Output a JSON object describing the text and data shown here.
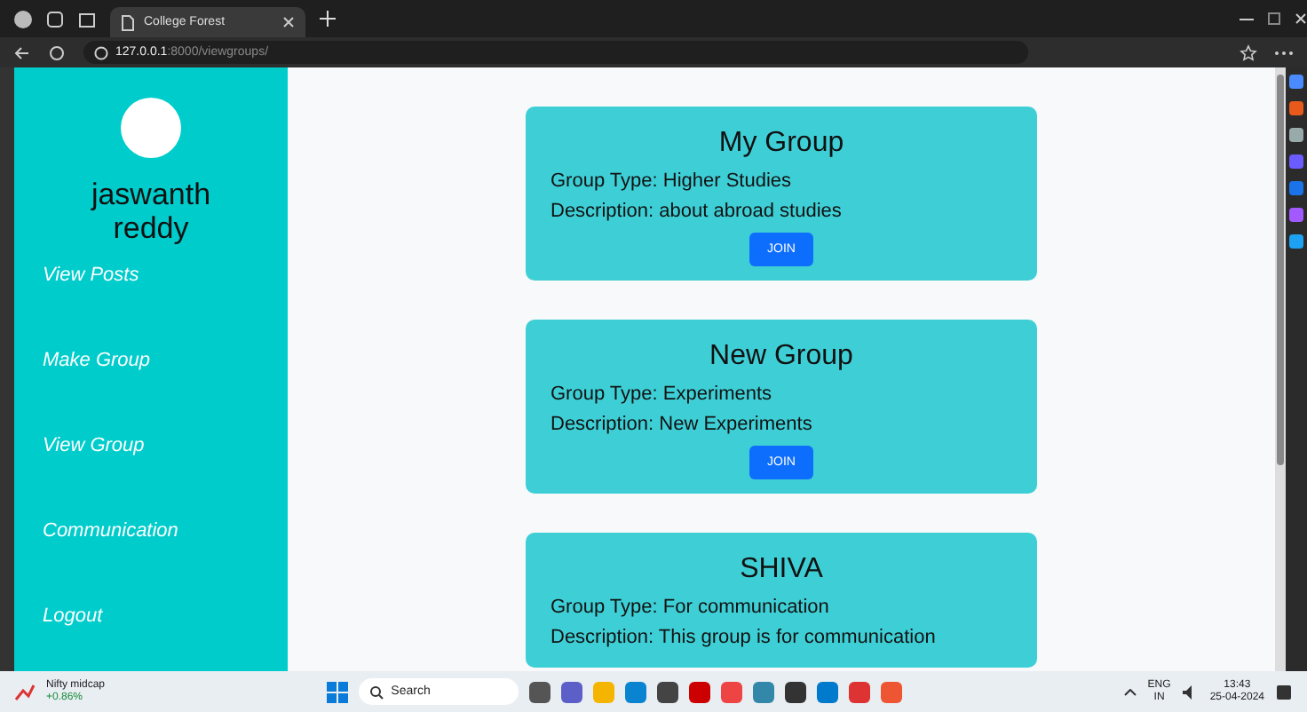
{
  "browser": {
    "tab_title": "College Forest",
    "url_host": "127.0.0.1",
    "url_path": ":8000/viewgroups/"
  },
  "sidebar": {
    "user_name": "jaswanth reddy",
    "items": [
      {
        "label": "View Posts"
      },
      {
        "label": "Make Group"
      },
      {
        "label": "View Group"
      },
      {
        "label": "Communication"
      },
      {
        "label": "Logout"
      }
    ]
  },
  "groups": [
    {
      "name": "My Group",
      "type_line": "Group Type: Higher Studies",
      "description_line": "Description: about abroad studies",
      "button": "JOIN"
    },
    {
      "name": "New Group",
      "type_line": "Group Type: Experiments",
      "description_line": "Description: New Experiments",
      "button": "JOIN"
    },
    {
      "name": "SHIVA",
      "type_line": "Group Type: For communication",
      "description_line": "Description: This group is for communication"
    }
  ],
  "taskbar": {
    "widget_title": "Nifty midcap",
    "widget_value": "+0.86%",
    "search": "Search",
    "lang": "ENG",
    "region": "IN",
    "time": "13:43",
    "date": "25-04-2024"
  }
}
